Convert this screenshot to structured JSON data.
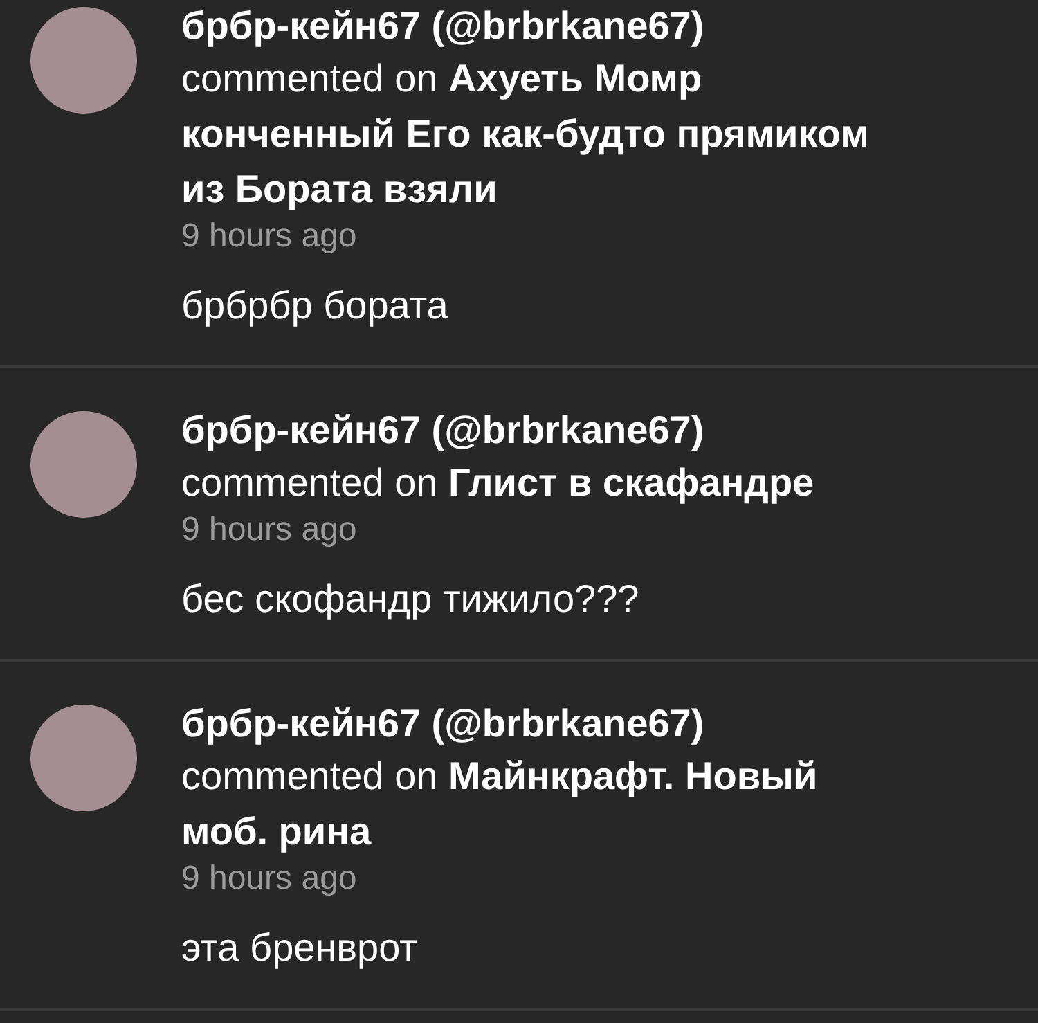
{
  "comments": [
    {
      "author": "брбр-кейн67 (@brbrkane67)",
      "action": "commented on",
      "post_title": "Ахуеть Момр конченный Его как-будто прямиком из Бората взяли",
      "time": "9 hours ago",
      "text": "брбрбр бората"
    },
    {
      "author": "брбр-кейн67 (@brbrkane67)",
      "action": "commented on",
      "post_title": "Глист в скафандре",
      "time": "9 hours ago",
      "text": "бес скофандр тижило???"
    },
    {
      "author": "брбр-кейн67 (@brbrkane67)",
      "action": "commented on",
      "post_title": "Майнкрафт. Новый моб. рина",
      "time": "9 hours ago",
      "text": "эта бренврот"
    }
  ]
}
